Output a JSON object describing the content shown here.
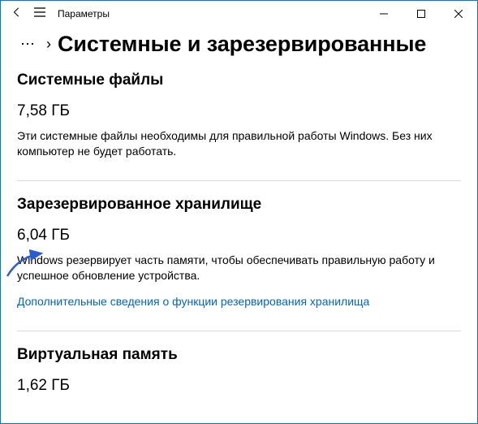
{
  "titlebar": {
    "app_title": "Параметры"
  },
  "breadcrumb": {
    "more_glyph": "⋯",
    "sep_glyph": "›",
    "page_title": "Системные и зарезервированные"
  },
  "sections": {
    "system_files": {
      "heading": "Системные файлы",
      "size": "7,58 ГБ",
      "desc": "Эти системные файлы необходимы для правильной работы Windows. Без них компьютер не будет работать."
    },
    "reserved_storage": {
      "heading": "Зарезервированное хранилище",
      "size": "6,04 ГБ",
      "desc": "Windows резервирует часть памяти, чтобы обеспечивать правильную работу и успешное обновление устройства.",
      "link": "Дополнительные сведения о функции резервирования хранилища"
    },
    "virtual_memory": {
      "heading": "Виртуальная память",
      "size": "1,62 ГБ"
    }
  }
}
